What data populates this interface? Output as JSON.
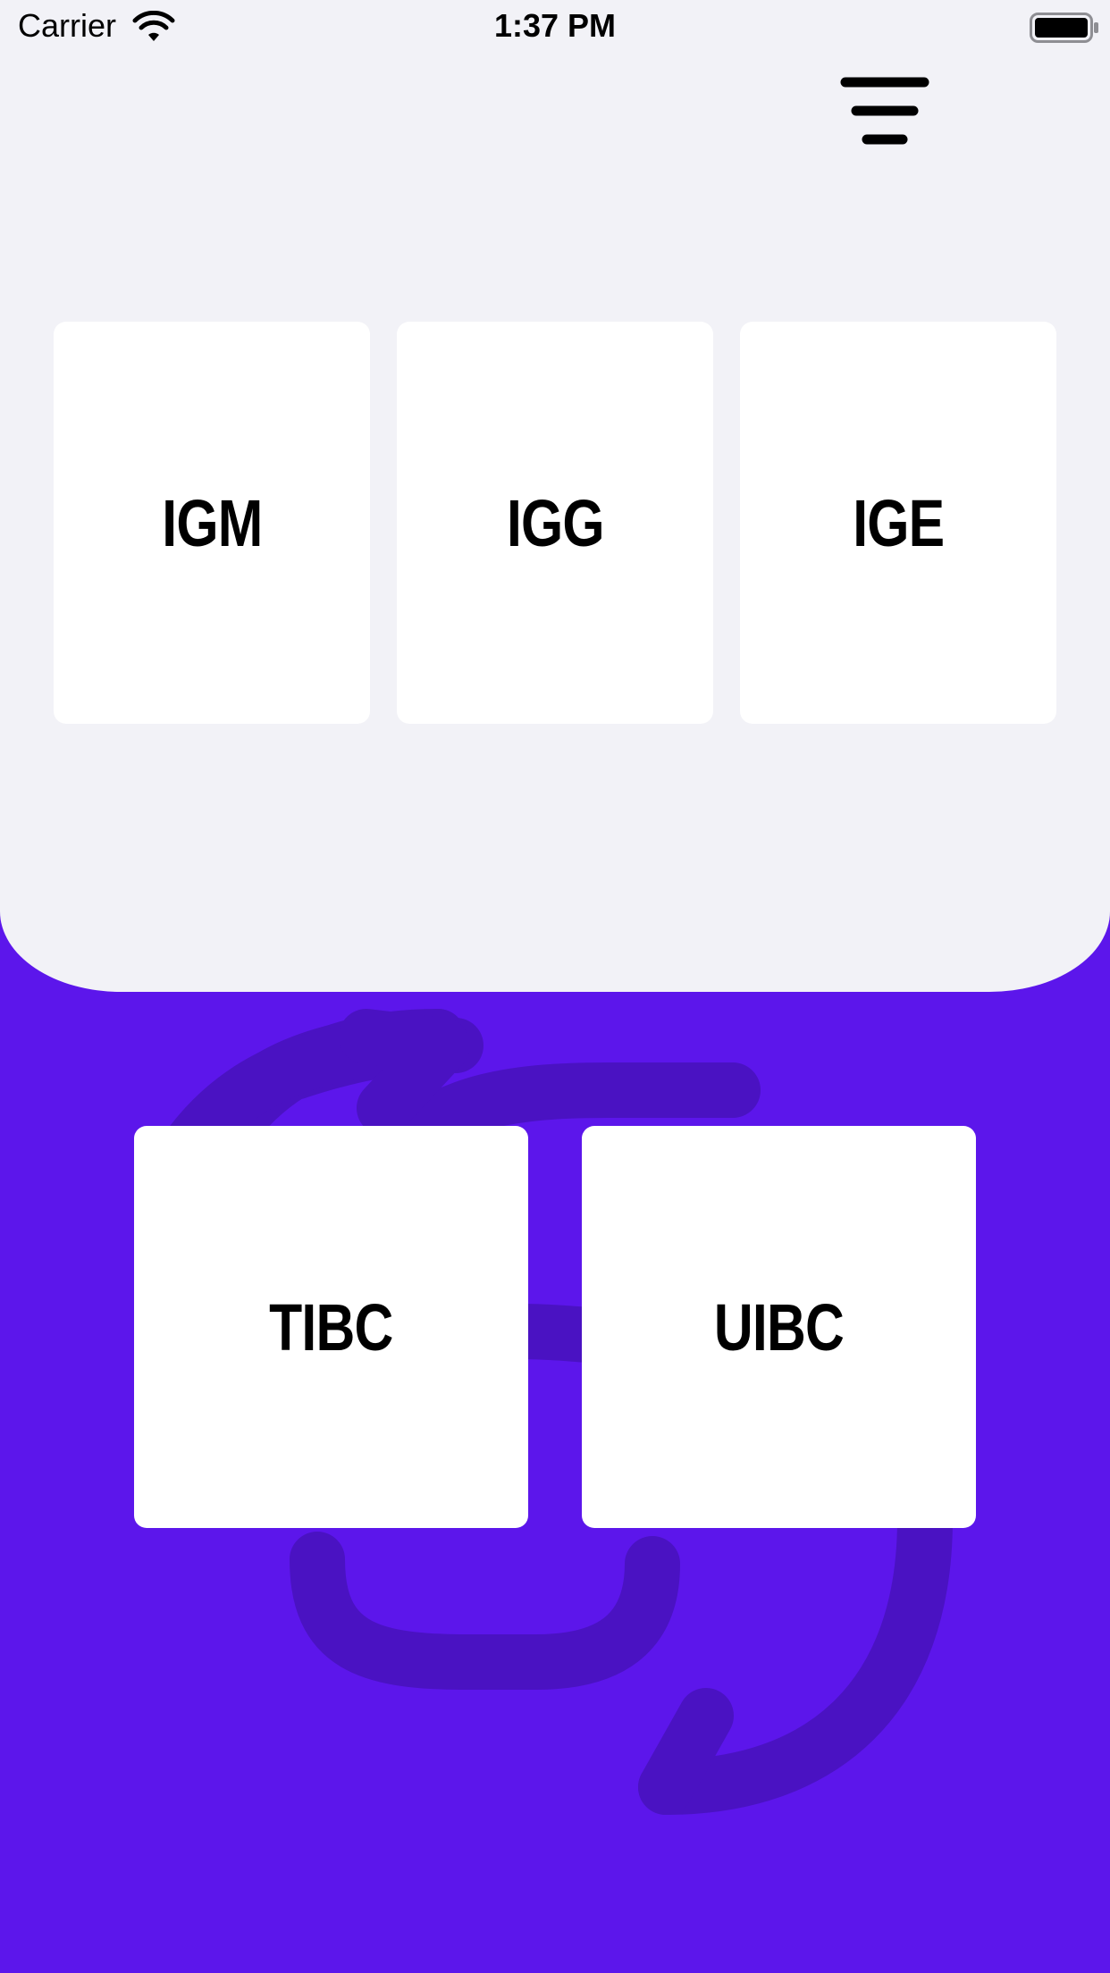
{
  "status_bar": {
    "carrier": "Carrier",
    "time": "1:37 PM",
    "wifi_icon": "wifi-icon",
    "battery_icon": "battery-icon"
  },
  "header": {
    "menu_icon": "menu-icon"
  },
  "top_cards": [
    {
      "label": "IGM"
    },
    {
      "label": "IGG"
    },
    {
      "label": "IGE"
    }
  ],
  "bottom_cards": [
    {
      "label": "TIBC"
    },
    {
      "label": "UIBC"
    }
  ],
  "background": {
    "icon": "swap-arrows-icon",
    "colors": {
      "primary": "#5c16eb",
      "panel": "#f2f2f7",
      "card": "#ffffff",
      "icon_tint": "#4a12c2"
    }
  }
}
